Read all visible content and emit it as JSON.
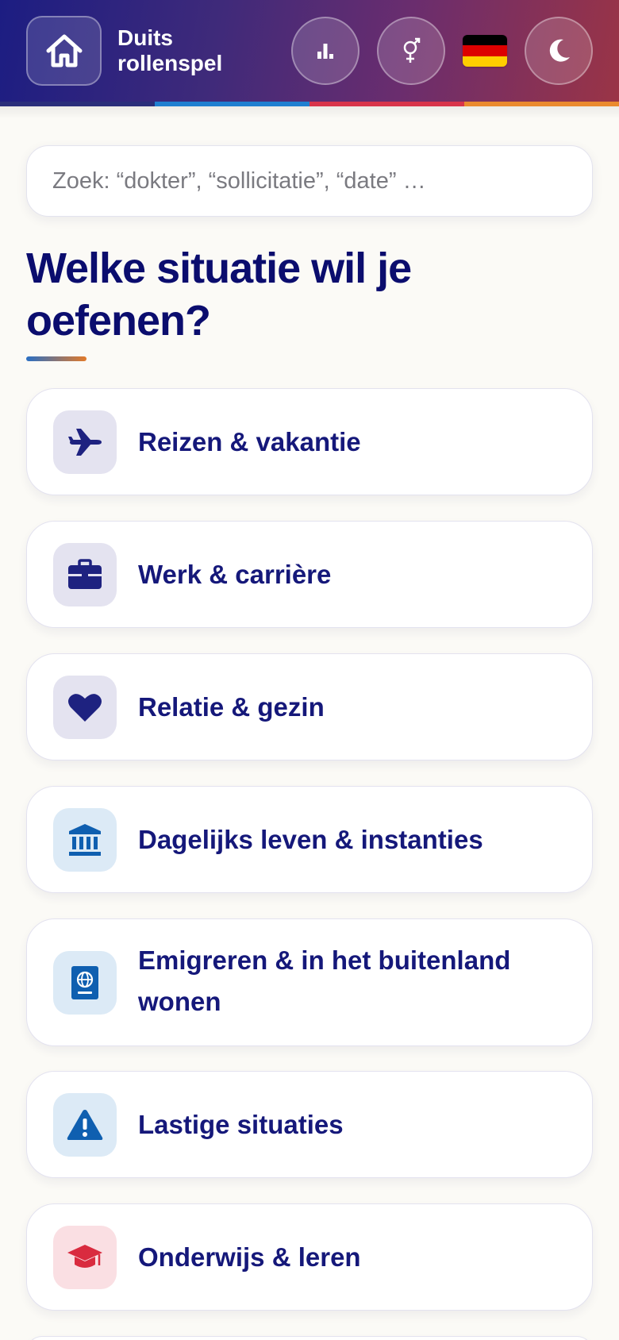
{
  "header": {
    "title_line1": "Duits",
    "title_line2": "rollenspel",
    "stripe_colors": [
      "#2a2e7a",
      "#1f7fd0",
      "#d8344a",
      "#ea8a2e"
    ]
  },
  "colors": {
    "accent_navy": "#0b0d6e",
    "flag_black": "#000000",
    "flag_red": "#dd0000",
    "flag_gold": "#ffce00"
  },
  "search": {
    "placeholder": "Zoek: “dokter”, “sollicitatie”, “date” …"
  },
  "heading": "Welke situatie wil je oefenen?",
  "categories": [
    {
      "label": "Reizen & vakantie",
      "icon": "plane-icon"
    },
    {
      "label": "Werk & carrière",
      "icon": "briefcase-icon"
    },
    {
      "label": "Relatie & gezin",
      "icon": "heart-icon"
    },
    {
      "label": "Dagelijks leven & instanties",
      "icon": "bank-icon"
    },
    {
      "label": "Emigreren & in het buitenland wonen",
      "icon": "passport-icon"
    },
    {
      "label": "Lastige situaties",
      "icon": "warning-icon"
    },
    {
      "label": "Onderwijs & leren",
      "icon": "graduation-cap-icon"
    }
  ]
}
